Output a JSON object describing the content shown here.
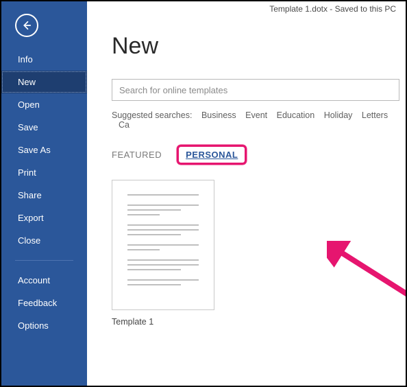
{
  "titlebar": "Template 1.dotx  -  Saved to this PC",
  "sidebar": {
    "items": [
      {
        "label": "Info"
      },
      {
        "label": "New"
      },
      {
        "label": "Open"
      },
      {
        "label": "Save"
      },
      {
        "label": "Save As"
      },
      {
        "label": "Print"
      },
      {
        "label": "Share"
      },
      {
        "label": "Export"
      },
      {
        "label": "Close"
      }
    ],
    "footer": [
      {
        "label": "Account"
      },
      {
        "label": "Feedback"
      },
      {
        "label": "Options"
      }
    ],
    "active_index": 1
  },
  "page": {
    "title": "New",
    "search_placeholder": "Search for online templates",
    "suggested_label": "Suggested searches:",
    "suggested": [
      "Business",
      "Event",
      "Education",
      "Holiday",
      "Letters",
      "Ca"
    ],
    "tabs": {
      "featured": "FEATURED",
      "personal": "PERSONAL",
      "active": "personal"
    },
    "templates": [
      {
        "name": "Template 1"
      }
    ]
  },
  "colors": {
    "accent": "#2b579a",
    "highlight": "#e6156f"
  }
}
